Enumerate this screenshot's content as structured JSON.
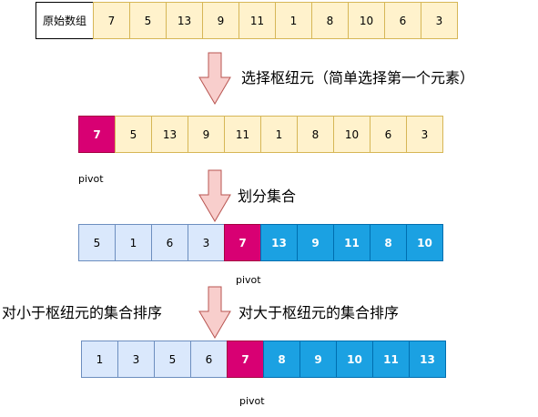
{
  "original_label": "原始数组",
  "original": [
    "7",
    "5",
    "13",
    "9",
    "11",
    "1",
    "8",
    "10",
    "6",
    "3"
  ],
  "step1": {
    "caption": "选择枢纽元（简单选择第一个元素）",
    "values": [
      "7",
      "5",
      "13",
      "9",
      "11",
      "1",
      "8",
      "10",
      "6",
      "3"
    ]
  },
  "step2": {
    "caption": "划分集合",
    "values": [
      "5",
      "1",
      "6",
      "3",
      "7",
      "13",
      "9",
      "11",
      "8",
      "10"
    ]
  },
  "step3": {
    "caption_left": "对小于枢纽元的集合排序",
    "caption_right": "对大于枢纽元的集合排序",
    "values": [
      "1",
      "3",
      "5",
      "6",
      "7",
      "8",
      "9",
      "10",
      "11",
      "13"
    ]
  },
  "pivot_label": "pivot",
  "colors": {
    "yellow": "#fff2cc",
    "pivot": "#d80073",
    "light_blue": "#dae8fc",
    "blue": "#1ba1e2",
    "arrow": "#f8cecc"
  }
}
